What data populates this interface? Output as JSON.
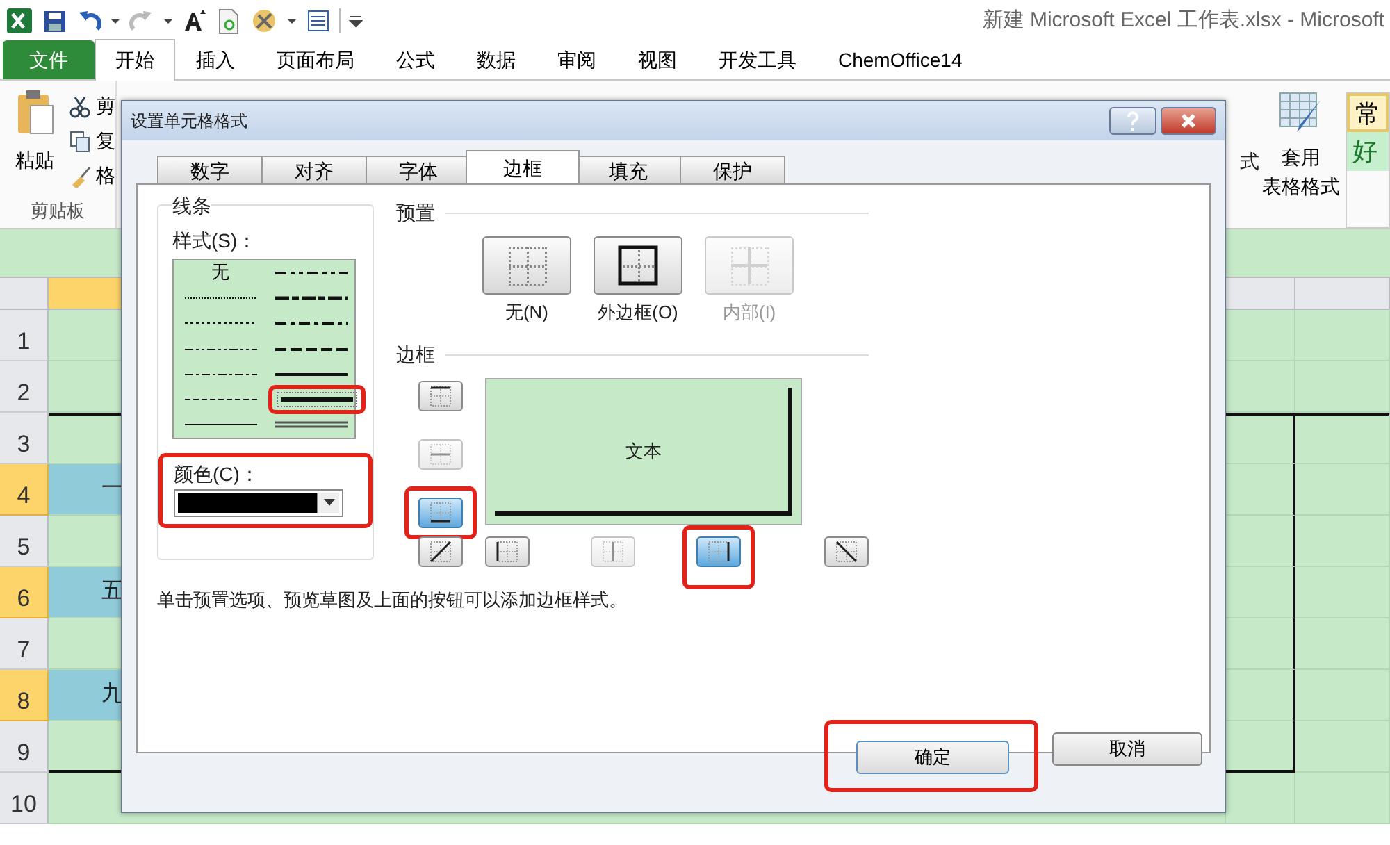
{
  "window": {
    "title": "新建 Microsoft Excel 工作表.xlsx - Microsoft"
  },
  "quick_access": [
    {
      "kind": "excel"
    },
    {
      "kind": "save"
    },
    {
      "kind": "undo"
    },
    {
      "kind": "caret"
    },
    {
      "kind": "redo"
    },
    {
      "kind": "caret"
    },
    {
      "kind": "font_grow"
    },
    {
      "kind": "document"
    },
    {
      "kind": "tools"
    },
    {
      "kind": "caret"
    },
    {
      "kind": "form"
    },
    {
      "kind": "customize"
    }
  ],
  "ribbon_tabs": [
    {
      "label": "文件",
      "kind": "file",
      "selected": false
    },
    {
      "label": "开始",
      "kind": "tab",
      "selected": true
    },
    {
      "label": "插入",
      "kind": "tab",
      "selected": false
    },
    {
      "label": "页面布局",
      "kind": "tab",
      "selected": false
    },
    {
      "label": "公式",
      "kind": "tab",
      "selected": false
    },
    {
      "label": "数据",
      "kind": "tab",
      "selected": false
    },
    {
      "label": "审阅",
      "kind": "tab",
      "selected": false
    },
    {
      "label": "视图",
      "kind": "tab",
      "selected": false
    },
    {
      "label": "开发工具",
      "kind": "tab",
      "selected": false
    },
    {
      "label": "ChemOffice14",
      "kind": "tab",
      "selected": false
    }
  ],
  "ribbon": {
    "paste": "粘贴",
    "clipboard_items": [
      {
        "kind": "cut",
        "label": "剪"
      },
      {
        "kind": "copy",
        "label": "复"
      },
      {
        "kind": "format_painter",
        "label": "格"
      }
    ],
    "clipboard_group": "剪贴板",
    "styles_partial": "式",
    "format_table": "套用",
    "format_table_2": "表格格式",
    "cell_styles": [
      {
        "label": "常",
        "color": "#fff2c4"
      },
      {
        "label": "好",
        "color": "#c6efce"
      }
    ]
  },
  "sheet": {
    "columns": [
      {
        "selected": true
      },
      {
        "selected": false
      },
      {
        "selected": false
      }
    ],
    "rows": [
      {
        "label": "1",
        "selected": false,
        "bordered": false
      },
      {
        "label": "2",
        "selected": false,
        "bordered": false
      },
      {
        "label": "3",
        "selected": false,
        "bordered": true
      },
      {
        "label": "4",
        "selected": true,
        "bordered": true,
        "cell": "一"
      },
      {
        "label": "5",
        "selected": false,
        "bordered": true
      },
      {
        "label": "6",
        "selected": true,
        "bordered": true,
        "cell": "五"
      },
      {
        "label": "7",
        "selected": false,
        "bordered": true
      },
      {
        "label": "8",
        "selected": true,
        "bordered": true,
        "cell": "九"
      },
      {
        "label": "9",
        "selected": false,
        "bordered": true
      },
      {
        "label": "10",
        "selected": false,
        "bordered": false
      }
    ]
  },
  "dialog": {
    "title": "设置单元格格式",
    "tabs": [
      {
        "label": "数字",
        "selected": false
      },
      {
        "label": "对齐",
        "selected": false
      },
      {
        "label": "字体",
        "selected": false
      },
      {
        "label": "边框",
        "selected": true
      },
      {
        "label": "填充",
        "selected": false
      },
      {
        "label": "保护",
        "selected": false
      }
    ],
    "line": {
      "label": "线条",
      "style_label": "样式(S)：",
      "styles": [
        {
          "kind": "none",
          "label": "无",
          "selected": false,
          "annotated": false
        },
        {
          "kind": "hair",
          "selected": false,
          "annotated": false
        },
        {
          "kind": "dotted",
          "selected": false,
          "annotated": false
        },
        {
          "kind": "dash_dot_dot",
          "selected": false,
          "annotated": false
        },
        {
          "kind": "dash_dot",
          "selected": false,
          "annotated": false
        },
        {
          "kind": "dashed",
          "selected": false,
          "annotated": false
        },
        {
          "kind": "thin",
          "selected": false,
          "annotated": false
        },
        {
          "kind": "medium_dash_dot_dot",
          "selected": false,
          "annotated": false
        },
        {
          "kind": "slant_dash_dot",
          "selected": false,
          "annotated": false
        },
        {
          "kind": "medium_dash_dot",
          "selected": false,
          "annotated": false
        },
        {
          "kind": "medium_dashed",
          "selected": false,
          "annotated": false
        },
        {
          "kind": "medium",
          "selected": false,
          "annotated": false
        },
        {
          "kind": "thick",
          "selected": true,
          "annotated": true
        },
        {
          "kind": "double",
          "selected": false,
          "annotated": false
        }
      ],
      "color_label": "颜色(C)：",
      "color": "#000000",
      "annotated": true
    },
    "presets": {
      "label": "预置",
      "items": [
        {
          "kind": "none",
          "label": "无(N)",
          "disabled": false
        },
        {
          "kind": "outline",
          "label": "外边框(O)",
          "disabled": false
        },
        {
          "kind": "inside",
          "label": "内部(I)",
          "disabled": true
        }
      ]
    },
    "border": {
      "label": "边框",
      "preview_text": "文本",
      "buttons": [
        {
          "kind": "top",
          "selected": false,
          "disabled": false,
          "annotated": false
        },
        {
          "kind": "middle_h",
          "selected": false,
          "disabled": true,
          "annotated": false
        },
        {
          "kind": "bottom",
          "selected": true,
          "disabled": false,
          "annotated": true
        },
        {
          "kind": "diag_up",
          "selected": false,
          "disabled": false,
          "annotated": false
        },
        {
          "kind": "left",
          "selected": false,
          "disabled": false,
          "annotated": false
        },
        {
          "kind": "middle_v",
          "selected": false,
          "disabled": true,
          "annotated": false
        },
        {
          "kind": "right",
          "selected": true,
          "disabled": false,
          "annotated": true
        },
        {
          "kind": "diag_down",
          "selected": false,
          "disabled": false,
          "annotated": false
        }
      ]
    },
    "hint": "单击预置选项、预览草图及上面的按钮可以添加边框样式。",
    "buttons": [
      {
        "label": "确定",
        "kind": "ok",
        "annotated": true
      },
      {
        "label": "取消",
        "kind": "cancel",
        "annotated": false
      }
    ]
  }
}
